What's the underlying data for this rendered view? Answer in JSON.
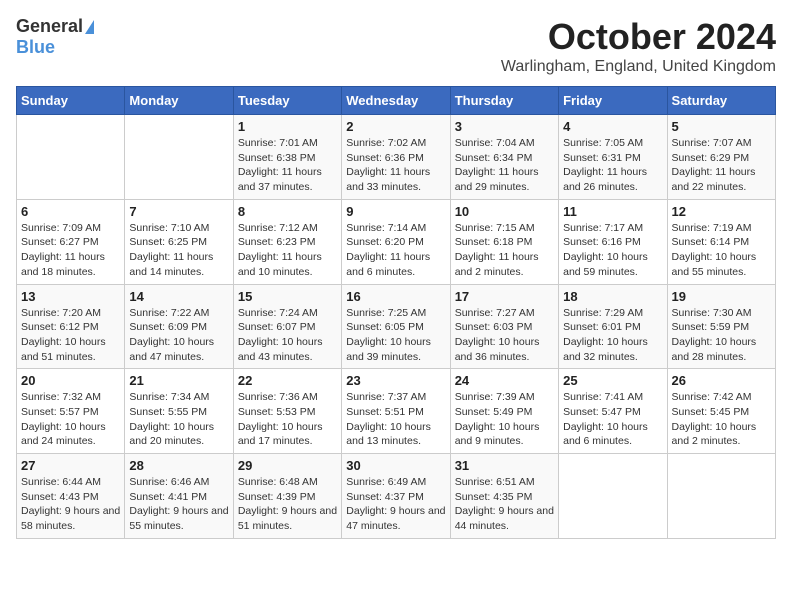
{
  "logo": {
    "general": "General",
    "blue": "Blue"
  },
  "title": {
    "month": "October 2024",
    "location": "Warlingham, England, United Kingdom"
  },
  "weekdays": [
    "Sunday",
    "Monday",
    "Tuesday",
    "Wednesday",
    "Thursday",
    "Friday",
    "Saturday"
  ],
  "weeks": [
    [
      {
        "day": "",
        "info": ""
      },
      {
        "day": "",
        "info": ""
      },
      {
        "day": "1",
        "info": "Sunrise: 7:01 AM\nSunset: 6:38 PM\nDaylight: 11 hours and 37 minutes."
      },
      {
        "day": "2",
        "info": "Sunrise: 7:02 AM\nSunset: 6:36 PM\nDaylight: 11 hours and 33 minutes."
      },
      {
        "day": "3",
        "info": "Sunrise: 7:04 AM\nSunset: 6:34 PM\nDaylight: 11 hours and 29 minutes."
      },
      {
        "day": "4",
        "info": "Sunrise: 7:05 AM\nSunset: 6:31 PM\nDaylight: 11 hours and 26 minutes."
      },
      {
        "day": "5",
        "info": "Sunrise: 7:07 AM\nSunset: 6:29 PM\nDaylight: 11 hours and 22 minutes."
      }
    ],
    [
      {
        "day": "6",
        "info": "Sunrise: 7:09 AM\nSunset: 6:27 PM\nDaylight: 11 hours and 18 minutes."
      },
      {
        "day": "7",
        "info": "Sunrise: 7:10 AM\nSunset: 6:25 PM\nDaylight: 11 hours and 14 minutes."
      },
      {
        "day": "8",
        "info": "Sunrise: 7:12 AM\nSunset: 6:23 PM\nDaylight: 11 hours and 10 minutes."
      },
      {
        "day": "9",
        "info": "Sunrise: 7:14 AM\nSunset: 6:20 PM\nDaylight: 11 hours and 6 minutes."
      },
      {
        "day": "10",
        "info": "Sunrise: 7:15 AM\nSunset: 6:18 PM\nDaylight: 11 hours and 2 minutes."
      },
      {
        "day": "11",
        "info": "Sunrise: 7:17 AM\nSunset: 6:16 PM\nDaylight: 10 hours and 59 minutes."
      },
      {
        "day": "12",
        "info": "Sunrise: 7:19 AM\nSunset: 6:14 PM\nDaylight: 10 hours and 55 minutes."
      }
    ],
    [
      {
        "day": "13",
        "info": "Sunrise: 7:20 AM\nSunset: 6:12 PM\nDaylight: 10 hours and 51 minutes."
      },
      {
        "day": "14",
        "info": "Sunrise: 7:22 AM\nSunset: 6:09 PM\nDaylight: 10 hours and 47 minutes."
      },
      {
        "day": "15",
        "info": "Sunrise: 7:24 AM\nSunset: 6:07 PM\nDaylight: 10 hours and 43 minutes."
      },
      {
        "day": "16",
        "info": "Sunrise: 7:25 AM\nSunset: 6:05 PM\nDaylight: 10 hours and 39 minutes."
      },
      {
        "day": "17",
        "info": "Sunrise: 7:27 AM\nSunset: 6:03 PM\nDaylight: 10 hours and 36 minutes."
      },
      {
        "day": "18",
        "info": "Sunrise: 7:29 AM\nSunset: 6:01 PM\nDaylight: 10 hours and 32 minutes."
      },
      {
        "day": "19",
        "info": "Sunrise: 7:30 AM\nSunset: 5:59 PM\nDaylight: 10 hours and 28 minutes."
      }
    ],
    [
      {
        "day": "20",
        "info": "Sunrise: 7:32 AM\nSunset: 5:57 PM\nDaylight: 10 hours and 24 minutes."
      },
      {
        "day": "21",
        "info": "Sunrise: 7:34 AM\nSunset: 5:55 PM\nDaylight: 10 hours and 20 minutes."
      },
      {
        "day": "22",
        "info": "Sunrise: 7:36 AM\nSunset: 5:53 PM\nDaylight: 10 hours and 17 minutes."
      },
      {
        "day": "23",
        "info": "Sunrise: 7:37 AM\nSunset: 5:51 PM\nDaylight: 10 hours and 13 minutes."
      },
      {
        "day": "24",
        "info": "Sunrise: 7:39 AM\nSunset: 5:49 PM\nDaylight: 10 hours and 9 minutes."
      },
      {
        "day": "25",
        "info": "Sunrise: 7:41 AM\nSunset: 5:47 PM\nDaylight: 10 hours and 6 minutes."
      },
      {
        "day": "26",
        "info": "Sunrise: 7:42 AM\nSunset: 5:45 PM\nDaylight: 10 hours and 2 minutes."
      }
    ],
    [
      {
        "day": "27",
        "info": "Sunrise: 6:44 AM\nSunset: 4:43 PM\nDaylight: 9 hours and 58 minutes."
      },
      {
        "day": "28",
        "info": "Sunrise: 6:46 AM\nSunset: 4:41 PM\nDaylight: 9 hours and 55 minutes."
      },
      {
        "day": "29",
        "info": "Sunrise: 6:48 AM\nSunset: 4:39 PM\nDaylight: 9 hours and 51 minutes."
      },
      {
        "day": "30",
        "info": "Sunrise: 6:49 AM\nSunset: 4:37 PM\nDaylight: 9 hours and 47 minutes."
      },
      {
        "day": "31",
        "info": "Sunrise: 6:51 AM\nSunset: 4:35 PM\nDaylight: 9 hours and 44 minutes."
      },
      {
        "day": "",
        "info": ""
      },
      {
        "day": "",
        "info": ""
      }
    ]
  ]
}
